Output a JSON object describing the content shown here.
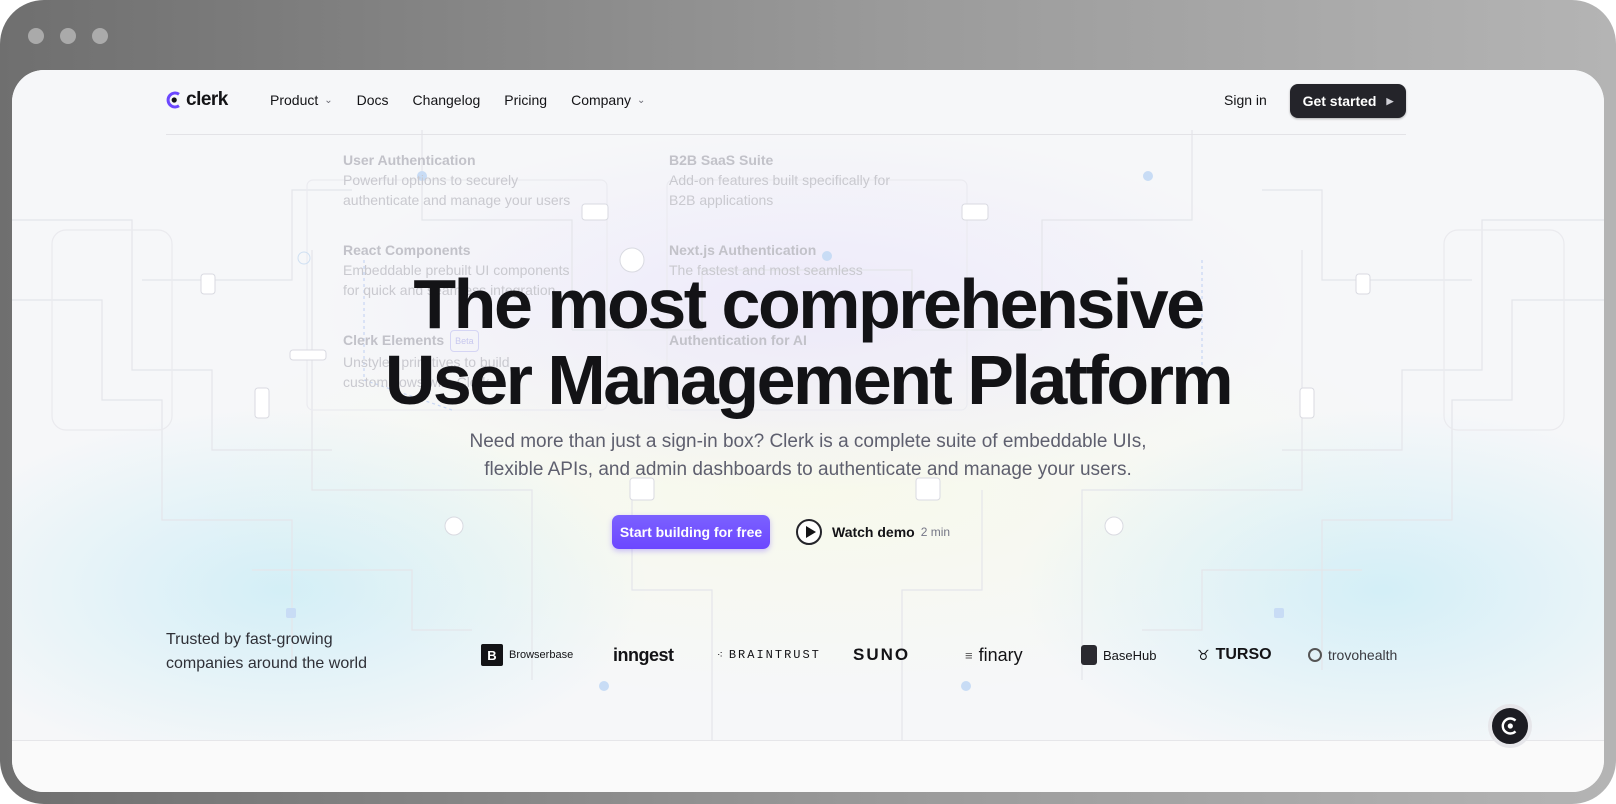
{
  "nav": {
    "logo_text": "clerk",
    "links": [
      {
        "label": "Product",
        "dropdown": true
      },
      {
        "label": "Docs",
        "dropdown": false
      },
      {
        "label": "Changelog",
        "dropdown": false
      },
      {
        "label": "Pricing",
        "dropdown": false
      },
      {
        "label": "Company",
        "dropdown": true
      }
    ],
    "sign_in": "Sign in",
    "get_started": "Get started"
  },
  "background_cards": [
    {
      "title": "User Authentication",
      "lines": [
        "Powerful options to securely",
        "authenticate and manage your users"
      ]
    },
    {
      "title": "B2B SaaS Suite",
      "lines": [
        "Add-on features built specifically for",
        "B2B applications"
      ]
    },
    {
      "title": "React Components",
      "lines": [
        "Embeddable prebuilt UI components",
        "for quick and seamless integration"
      ]
    },
    {
      "title": "Next.js Authentication",
      "lines": [
        "The fastest and most seamless"
      ]
    },
    {
      "title": "Clerk Elements",
      "badge": "Beta",
      "lines": [
        "Unstyled primitives to build",
        "custom flows with Clerk"
      ]
    },
    {
      "title": "Authentication for AI",
      "lines": []
    }
  ],
  "hero": {
    "headline_line1": "The most comprehensive",
    "headline_line2": "User Management Platform",
    "subtitle_line1": "Need more than just a sign-in box? Clerk is a complete suite of embeddable UIs,",
    "subtitle_line2": "flexible APIs, and admin dashboards to authenticate and manage your users.",
    "cta_primary": "Start building for free",
    "watch_demo": "Watch demo",
    "demo_duration": "2 min"
  },
  "trusted": {
    "line1": "Trusted by fast-growing",
    "line2": "companies around the world",
    "logos": [
      "Browserbase",
      "inngest",
      "BRAINTRUST",
      "SUNO",
      "finary",
      "BaseHub",
      "TURSO",
      "trovohealth"
    ]
  },
  "colors": {
    "accent": "#6c47ff",
    "text": "#131316",
    "muted": "#5e5f6e",
    "dark_button": "#24242a"
  },
  "icons": {
    "chevron": "chevron-down-icon",
    "arrow": "triangle-right-icon",
    "play": "play-icon",
    "fab": "clerk-logo-icon"
  }
}
